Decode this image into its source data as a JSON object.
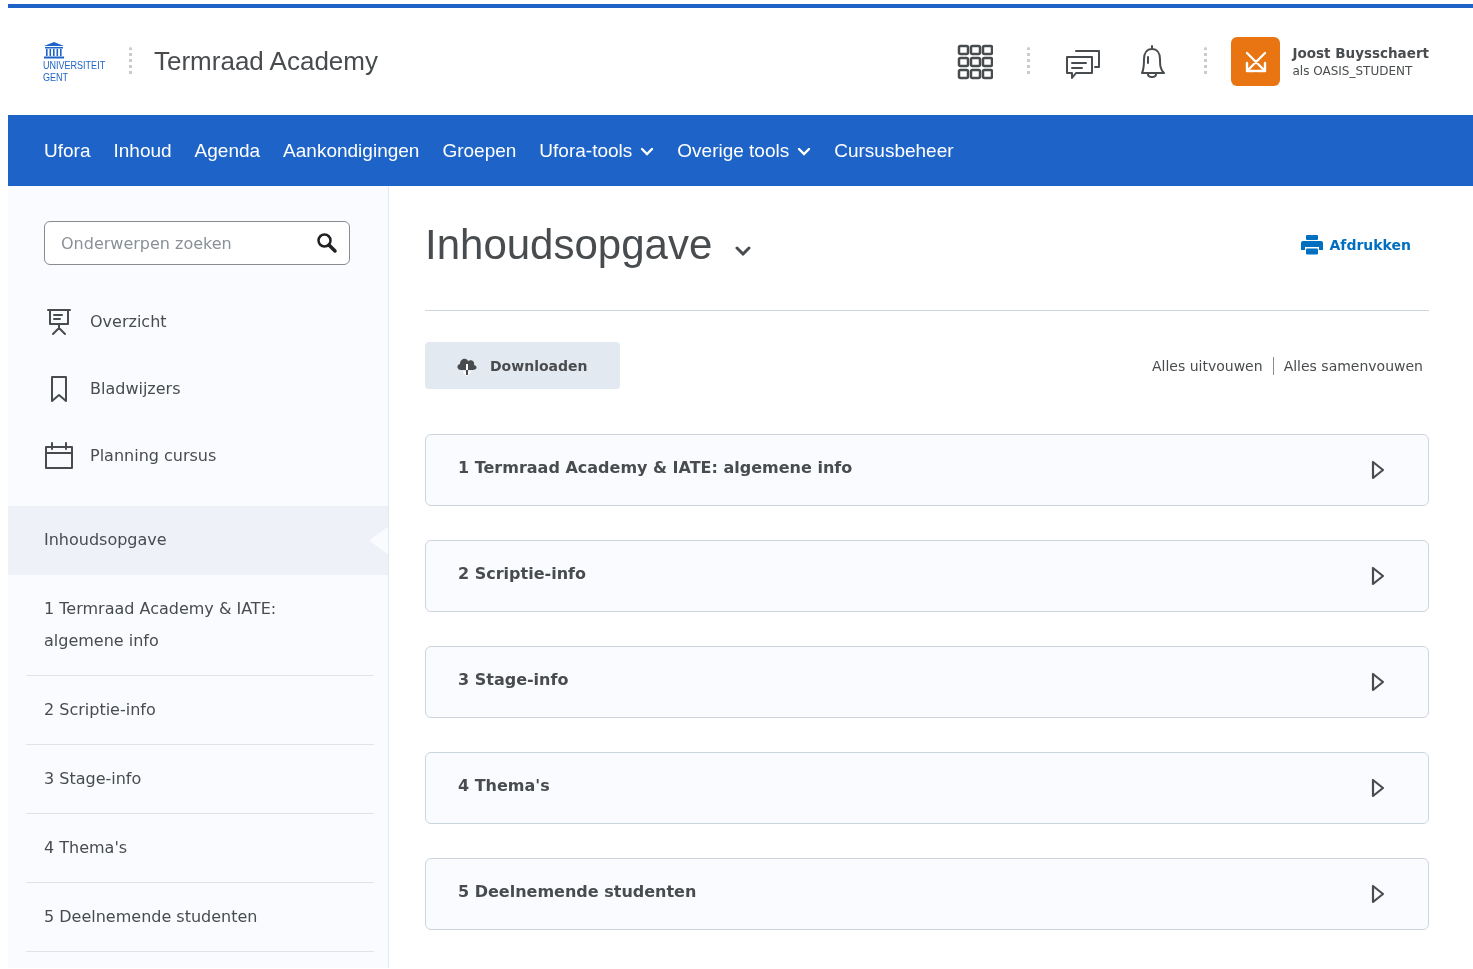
{
  "header": {
    "logo_lines": [
      "UNIVERSITEIT",
      "GENT"
    ],
    "course_title": "Termraad Academy",
    "user": {
      "name": "Joost Buysschaert",
      "role": "als OASIS_STUDENT"
    }
  },
  "navbar": [
    {
      "label": "Ufora",
      "kind": "link"
    },
    {
      "label": "Inhoud",
      "kind": "link"
    },
    {
      "label": "Agenda",
      "kind": "link"
    },
    {
      "label": "Aankondigingen",
      "kind": "link"
    },
    {
      "label": "Groepen",
      "kind": "link"
    },
    {
      "label": "Ufora-tools",
      "kind": "menu"
    },
    {
      "label": "Overige tools",
      "kind": "menu"
    },
    {
      "label": "Cursusbeheer",
      "kind": "link"
    }
  ],
  "sidebar": {
    "search": {
      "placeholder": "Onderwerpen zoeken"
    },
    "tools": [
      {
        "label": "Overzicht",
        "kind": "overview"
      },
      {
        "label": "Bladwijzers",
        "kind": "bookmarks"
      },
      {
        "label": "Planning cursus",
        "kind": "calendar"
      }
    ],
    "items": [
      {
        "label": "Inhoudsopgave",
        "selected": true
      },
      {
        "label": "1 Termraad Academy & IATE: algemene info",
        "selected": false
      },
      {
        "label": "2 Scriptie-info",
        "selected": false
      },
      {
        "label": "3 Stage-info",
        "selected": false
      },
      {
        "label": "4 Thema's",
        "selected": false
      },
      {
        "label": "5 Deelnemende studenten",
        "selected": false
      }
    ]
  },
  "main": {
    "title": "Inhoudsopgave",
    "print_link": "Afdrukken",
    "download_button": "Downloaden",
    "expand_all": "Alles uitvouwen",
    "collapse_all": "Alles samenvouwen",
    "modules": [
      {
        "title": "1 Termraad Academy & IATE: algemene info",
        "expanded": false
      },
      {
        "title": "2 Scriptie-info",
        "expanded": false
      },
      {
        "title": "3 Stage-info",
        "expanded": false
      },
      {
        "title": "4 Thema's",
        "expanded": false
      },
      {
        "title": "5 Deelnemende studenten",
        "expanded": false
      }
    ]
  }
}
